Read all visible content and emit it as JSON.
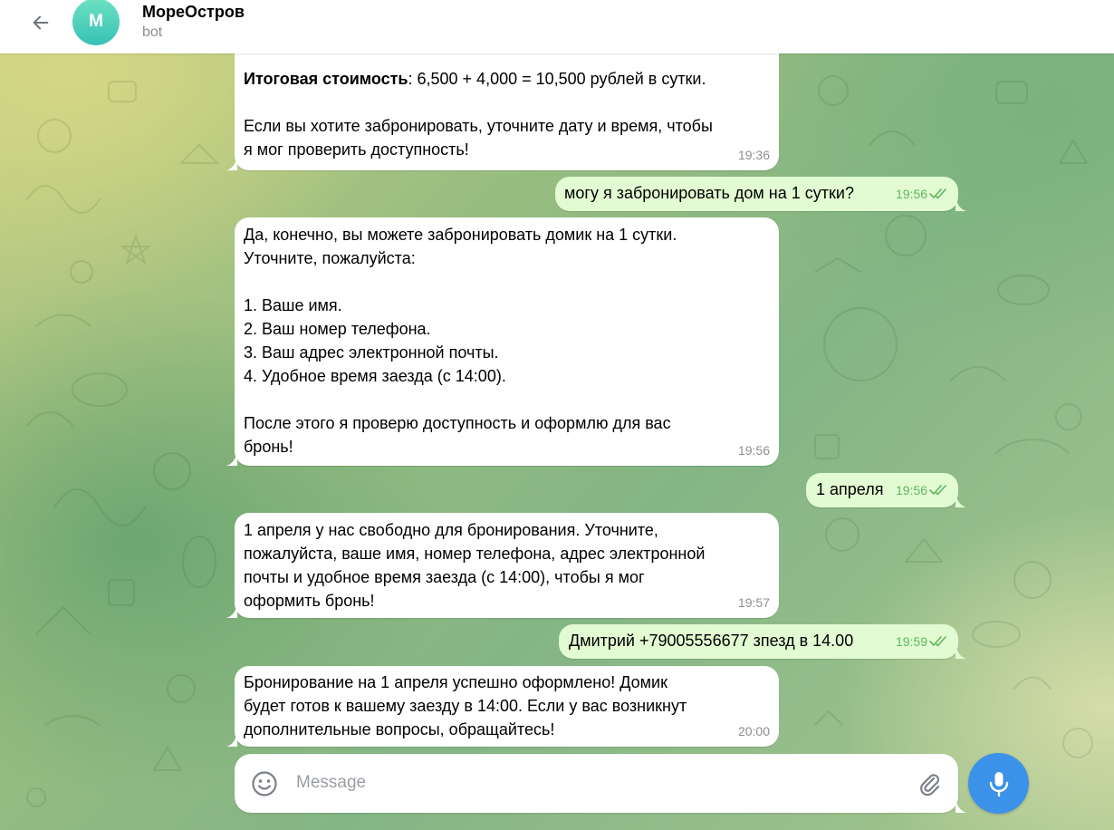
{
  "header": {
    "avatar_letter": "M",
    "title": "МореОстров",
    "subtitle": "bot",
    "back_icon": "arrow-left-icon"
  },
  "colors": {
    "incoming_bubble": "#ffffff",
    "outgoing_bubble": "#e2fbd2",
    "read_check": "#5fb55d",
    "mic_button": "#3b92e8",
    "avatar_gradient": [
      "#6fe0c3",
      "#35c2b4"
    ]
  },
  "messages": [
    {
      "direction": "in",
      "bold_prefix": "Итоговая стоимость",
      "text_after_bold": ": 6,500 + 4,000 = 10,500 рублей в сутки.\n\nЕсли вы хотите забронировать, уточните дату и время, чтобы\nя мог проверить доступность!",
      "time": "19:36"
    },
    {
      "direction": "out",
      "text": "могу я забронировать дом на 1 сутки?",
      "time": "19:56",
      "status": "read"
    },
    {
      "direction": "in",
      "text": "Да, конечно, вы можете забронировать домик на 1 сутки.\nУточните, пожалуйста:\n\n1. Ваше имя.\n2. Ваш номер телефона.\n3. Ваш адрес электронной почты.\n4. Удобное время заезда (с 14:00).\n\nПосле этого я проверю доступность и оформлю для вас\nбронь!",
      "time": "19:56"
    },
    {
      "direction": "out",
      "text": "1 апреля",
      "time": "19:56",
      "status": "read"
    },
    {
      "direction": "in",
      "text": "1 апреля у нас свободно для бронирования. Уточните,\nпожалуйста, ваше имя, номер телефона, адрес электронной\nпочты и удобное время заезда (с 14:00), чтобы я мог\nоформить бронь!",
      "time": "19:57"
    },
    {
      "direction": "out",
      "text": "Дмитрий +79005556677 зпезд в 14.00",
      "time": "19:59",
      "status": "read"
    },
    {
      "direction": "in",
      "text": "Бронирование на 1 апреля успешно оформлено! Домик\nбудет готов к вашему заезду в 14:00. Если у вас возникнут\nдополнительные вопросы, обращайтесь!",
      "time": "20:00"
    }
  ],
  "composer": {
    "placeholder": "Message",
    "value": "",
    "emoji_icon": "smiley-icon",
    "attach_icon": "paperclip-icon",
    "mic_icon": "microphone-icon"
  }
}
